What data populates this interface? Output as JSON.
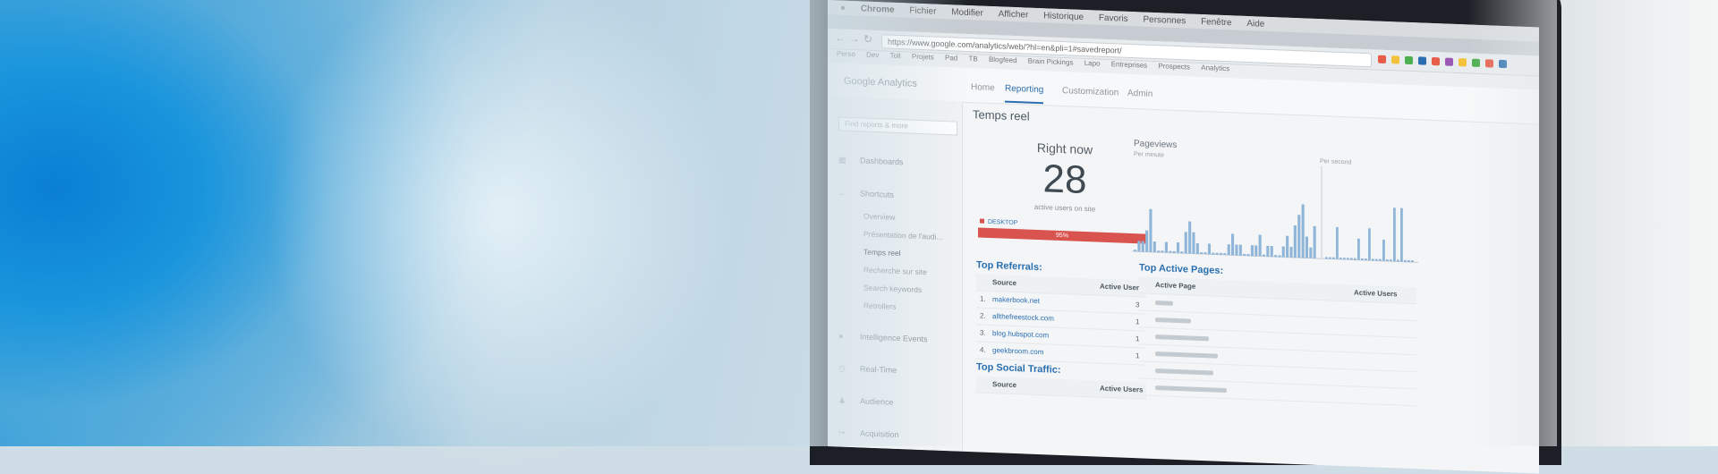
{
  "browser": {
    "menu": [
      "Chrome",
      "Fichier",
      "Modifier",
      "Afficher",
      "Historique",
      "Favoris",
      "Personnes",
      "Fenêtre",
      "Aide"
    ],
    "url": "https://www.google.com/analytics/web/?hl=en&pli=1#savedreport/",
    "bookmarks": [
      "Perso",
      "Dev",
      "Toll",
      "Projets",
      "Pad",
      "TB",
      "Blogfeed",
      "Brain Pickings",
      "Lapo",
      "Entreprises",
      "Prospects",
      "Analytics"
    ]
  },
  "ga": {
    "logo": "Google Analytics",
    "tabs": [
      "Home",
      "Reporting",
      "Customization",
      "Admin"
    ],
    "active_tab": "Reporting"
  },
  "sidebar": {
    "search_placeholder": "Find reports & more",
    "dashboards": "Dashboards",
    "shortcuts": "Shortcuts",
    "shortcut_items": [
      "Overview",
      "Présentation de l'audi...",
      "Temps reel",
      "Recherche sur site",
      "Search keywords",
      "Retrollers"
    ],
    "active_shortcut": "Temps reel",
    "intelligence_events": "Intelligence Events",
    "real_time": "Real-Time",
    "audience": "Audience",
    "acquisition": "Acquisition"
  },
  "main": {
    "page_title": "Temps reel",
    "right_now_label": "Right now",
    "active_users_count": "28",
    "active_users_label": "active users on site",
    "device_label": "DESKTOP",
    "device_share_label": "95%",
    "device_share": 0.95,
    "pageviews_title": "Pageviews",
    "per_minute_label": "Per minute",
    "per_second_label": "Per second"
  },
  "top_referrals": {
    "title": "Top Referrals:",
    "columns": [
      "Source",
      "Active Users"
    ],
    "rows": [
      {
        "rank": "1.",
        "source": "makerbook.net",
        "users": "3"
      },
      {
        "rank": "2.",
        "source": "allthefreestock.com",
        "users": "1"
      },
      {
        "rank": "3.",
        "source": "blog.hubspot.com",
        "users": "1"
      },
      {
        "rank": "4.",
        "source": "geekbroom.com",
        "users": "1"
      }
    ]
  },
  "top_active_pages": {
    "title": "Top Active Pages:",
    "columns": [
      "Active Page",
      "Active Users"
    ]
  },
  "top_social": {
    "title": "Top Social Traffic:",
    "columns": [
      "Source",
      "Active Users"
    ]
  },
  "colors": {
    "accent": "#2a6fb0",
    "device_bar": "#d9534f",
    "chart_bars": "#8fb5d8"
  },
  "chart_data": {
    "type": "bar",
    "series": [
      {
        "values": [
          0,
          1,
          1,
          2,
          4,
          1,
          0,
          0,
          1,
          0,
          0,
          1,
          0,
          2,
          3,
          2,
          1,
          0,
          0,
          1,
          0,
          0,
          0,
          0,
          1,
          2,
          1,
          1,
          0,
          0,
          1,
          1,
          2,
          0,
          1,
          1,
          0,
          0,
          1,
          2,
          1,
          3,
          4,
          5,
          2,
          1,
          3
        ]
      },
      {
        "values": [
          0,
          0,
          0,
          3,
          0,
          0,
          0,
          0,
          0,
          2,
          0,
          0,
          3,
          0,
          0,
          0,
          2,
          0,
          0,
          5,
          0,
          5,
          0,
          0,
          0
        ]
      }
    ],
    "labels": [
      "Per minute",
      "Per second"
    ]
  }
}
